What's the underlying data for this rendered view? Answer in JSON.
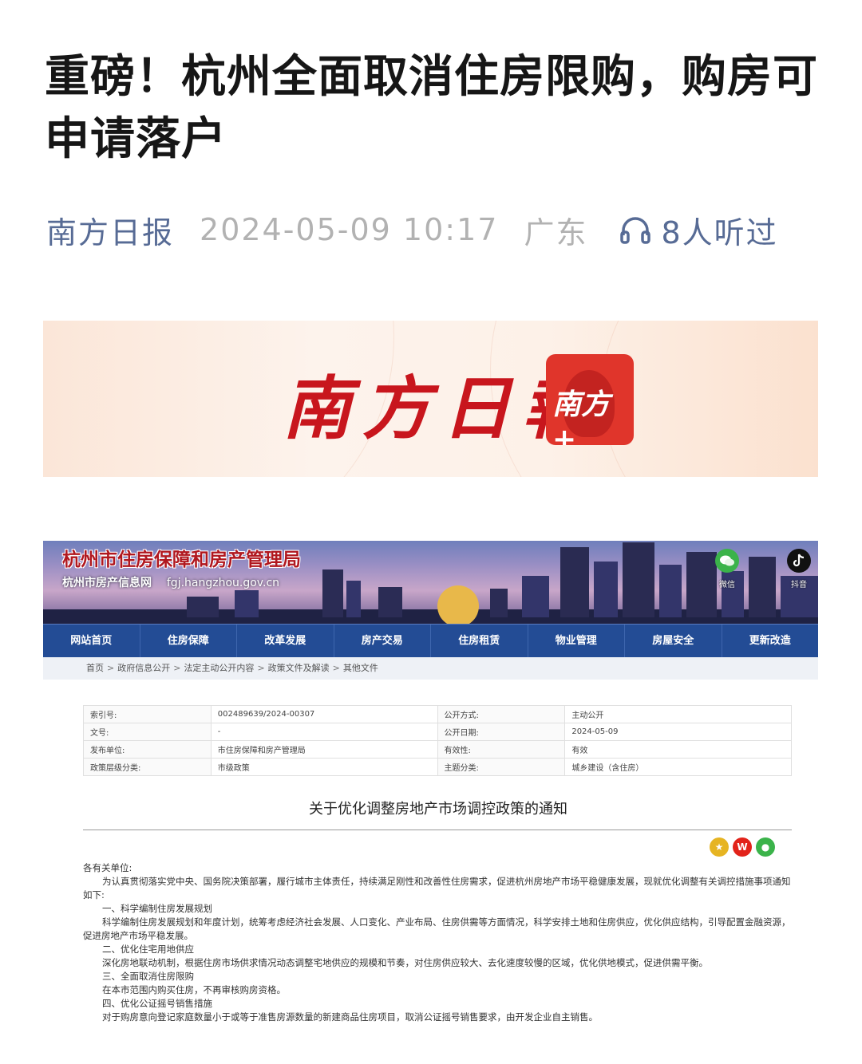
{
  "article": {
    "title": "重磅！杭州全面取消住房限购，购房可申请落户",
    "source": "南方日报",
    "datetime": "2024-05-09 10:17",
    "region": "广东",
    "listen_count": "8人听过"
  },
  "banner": {
    "brand": "南方日報",
    "app_label": "南方+",
    "accent_color": "#c8161d"
  },
  "gov_site": {
    "title": "杭州市住房保障和房产管理局",
    "subtitle": "杭州市房产信息网",
    "url": "fgj.hangzhou.gov.cn",
    "social": [
      {
        "label": "微信",
        "icon": "wechat-icon"
      },
      {
        "label": "抖音",
        "icon": "douyin-icon"
      }
    ],
    "nav": [
      "网站首页",
      "住房保障",
      "改革发展",
      "房产交易",
      "住房租赁",
      "物业管理",
      "房屋安全",
      "更新改造"
    ],
    "breadcrumb": [
      "首页",
      "政府信息公开",
      "法定主动公开内容",
      "政策文件及解读",
      "其他文件"
    ],
    "info_table": [
      [
        "索引号:",
        "002489639/2024-00307",
        "公开方式:",
        "主动公开"
      ],
      [
        "文号:",
        "-",
        "公开日期:",
        "2024-05-09"
      ],
      [
        "发布单位:",
        "市住房保障和房产管理局",
        "有效性:",
        "有效"
      ],
      [
        "政策层级分类:",
        "市级政策",
        "主题分类:",
        "城乡建设（含住房）"
      ]
    ],
    "doc_title": "关于优化调整房地产市场调控政策的通知",
    "body": [
      "各有关单位:",
      "为认真贯彻落实党中央、国务院决策部署，履行城市主体责任，持续满足刚性和改善性住房需求，促进杭州房地产市场平稳健康发展，现就优化调整有关调控措施事项通知如下:",
      "一、科学编制住房发展规划",
      "科学编制住房发展规划和年度计划，统筹考虑经济社会发展、人口变化、产业布局、住房供需等方面情况，科学安排土地和住房供应，优化供应结构，引导配置金融资源，促进房地产市场平稳发展。",
      "二、优化住宅用地供应",
      "深化房地联动机制，根据住房市场供求情况动态调整宅地供应的规模和节奏，对住房供应较大、去化速度较慢的区域，优化供地模式，促进供需平衡。",
      "三、全面取消住房限购",
      "在本市范围内购买住房，不再审核购房资格。",
      "四、优化公证摇号销售措施",
      "对于购房意向登记家庭数量小于或等于准售房源数量的新建商品住房项目，取消公证摇号销售要求，由开发企业自主销售。"
    ]
  }
}
